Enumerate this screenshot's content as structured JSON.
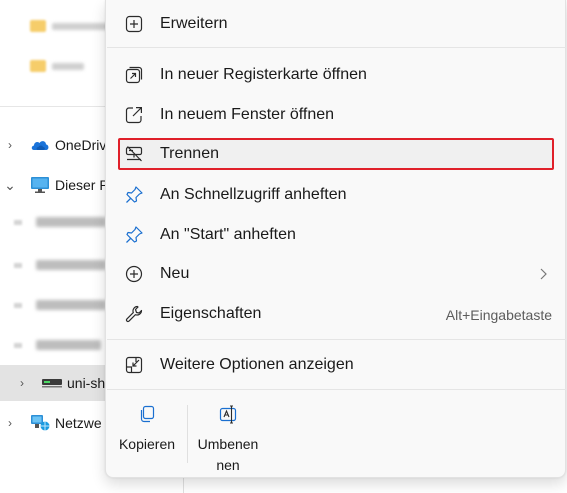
{
  "navigation": {
    "items": [
      {
        "label": "OneDriv",
        "icon": "onedrive-cloud-icon",
        "chevron": "›"
      },
      {
        "label": "Dieser P",
        "icon": "this-pc-monitor-icon",
        "chevron": "⌄"
      },
      {
        "label": "uni-sh",
        "icon": "network-drive-icon",
        "chevron": "›"
      },
      {
        "label": "Netzwe",
        "icon": "network-icon",
        "chevron": "›"
      }
    ]
  },
  "context_menu": {
    "items": [
      {
        "label": "Erweitern",
        "icon": "expand-plus-icon"
      },
      {
        "label": "In neuer Registerkarte öffnen",
        "icon": "open-new-tab-icon"
      },
      {
        "label": "In neuem Fenster öffnen",
        "icon": "open-new-window-icon"
      },
      {
        "label": "Trennen",
        "icon": "disconnect-drive-icon"
      },
      {
        "label": "An Schnellzugriff anheften",
        "icon": "pin-icon"
      },
      {
        "label": "An \"Start\" anheften",
        "icon": "pin-icon"
      },
      {
        "label": "Neu",
        "icon": "new-circle-plus-icon",
        "arrow": "chevron-right-icon"
      },
      {
        "label": "Eigenschaften",
        "icon": "wrench-icon",
        "shortcut": "Alt+Eingabetaste"
      },
      {
        "label": "Weitere Optionen anzeigen",
        "icon": "more-options-icon"
      }
    ],
    "commands": [
      {
        "label": "Kopieren",
        "icon": "copy-icon"
      },
      {
        "label": "Umbenennen",
        "icon": "rename-icon"
      }
    ],
    "highlighted_item": "Trennen",
    "colors": {
      "accent": "#0067c0",
      "highlight_border": "#e0202a",
      "menu_bg": "#f9f9f9"
    }
  }
}
